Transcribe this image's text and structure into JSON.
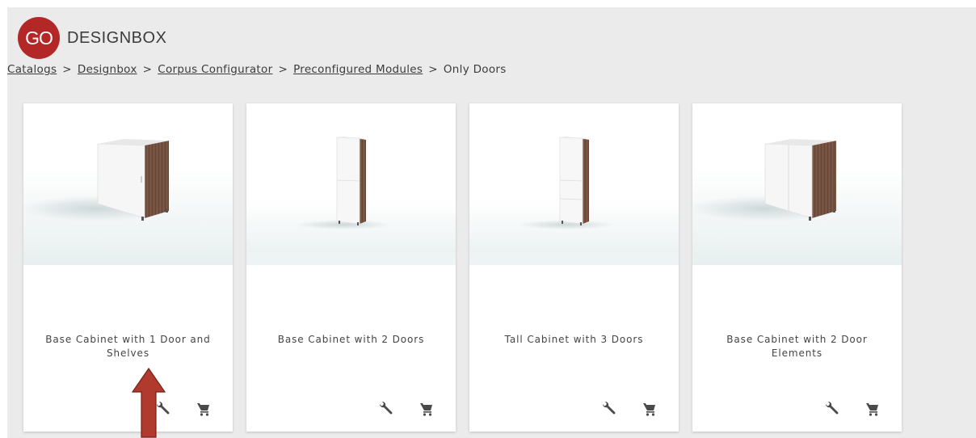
{
  "brand": {
    "badge": "GO",
    "name": "DESIGNBOX",
    "badge_color": "#b42727"
  },
  "breadcrumb": {
    "links": [
      "Catalogs",
      "Designbox",
      "Corpus Configurator",
      "Preconfigured Modules"
    ],
    "separator": ">",
    "current": "Only Doors"
  },
  "products": [
    {
      "title": "Base Cabinet with 1 Door and Shelves",
      "image_icon": "base-cabinet-1-door-image"
    },
    {
      "title": "Base Cabinet with 2 Doors",
      "image_icon": "tall-narrow-cabinet-image"
    },
    {
      "title": "Tall Cabinet with 3 Doors",
      "image_icon": "tall-narrow-cabinet-image"
    },
    {
      "title": "Base Cabinet with 2 Door Elements",
      "image_icon": "base-cabinet-2-door-image"
    }
  ],
  "card_actions": [
    "wrench-icon",
    "cart-icon"
  ],
  "annotation": {
    "icon": "up-arrow-annotation",
    "color": "#b03a2e"
  }
}
